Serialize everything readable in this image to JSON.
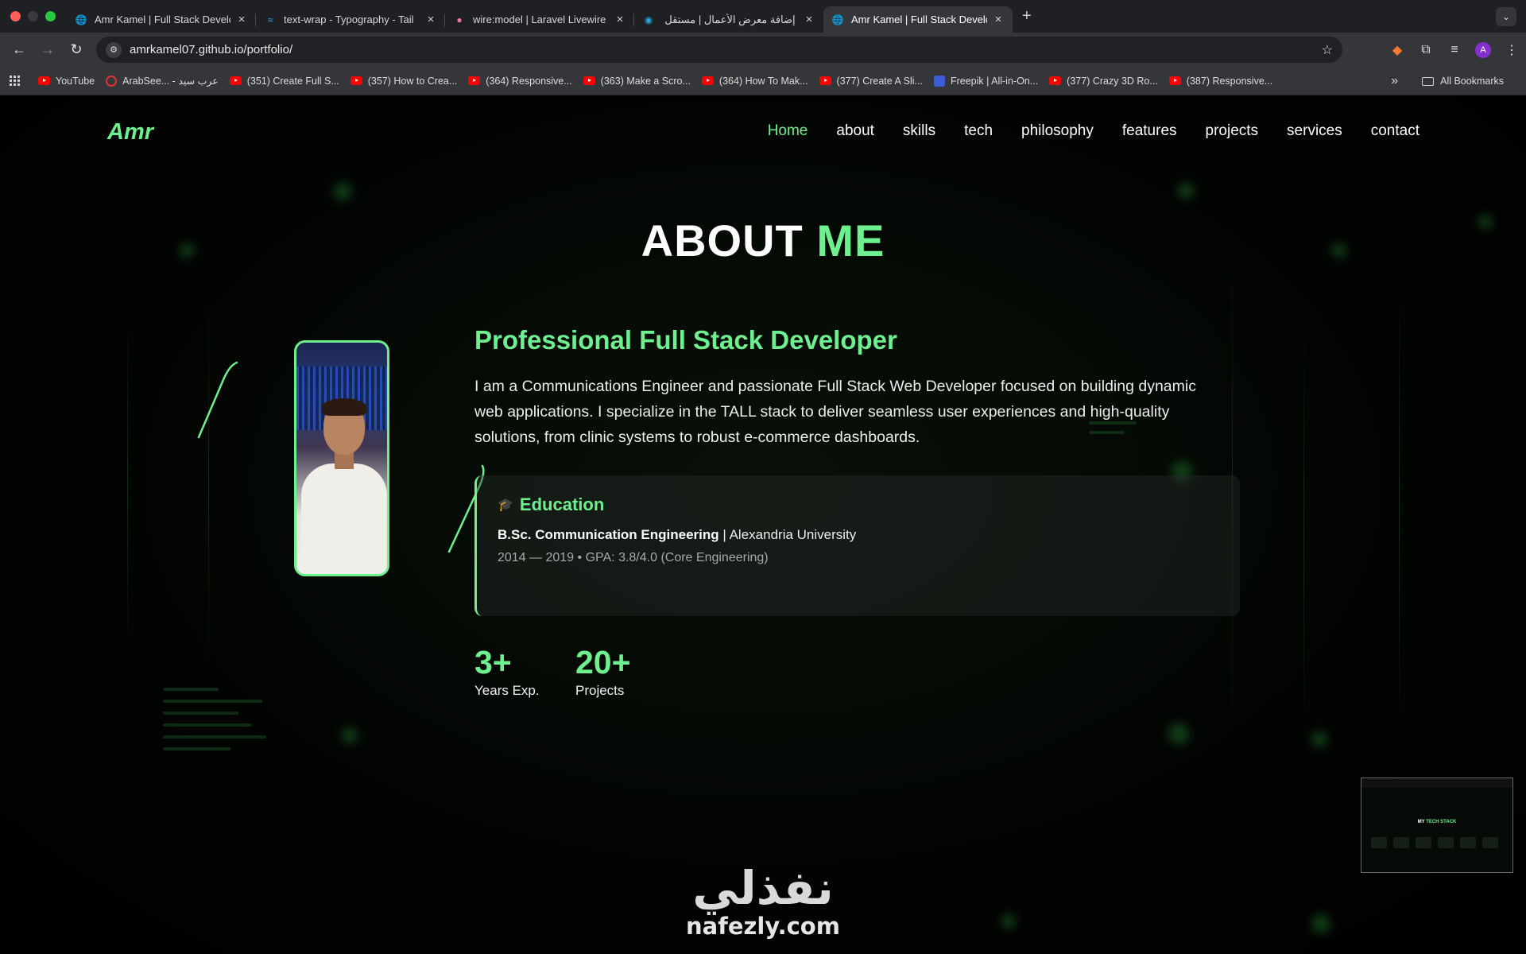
{
  "browser": {
    "tabs": [
      {
        "title": "Amr Kamel | Full Stack Develo",
        "icon": "globe-icon"
      },
      {
        "title": "text-wrap - Typography - Tail",
        "icon": "tailwind-icon"
      },
      {
        "title": "wire:model | Laravel Livewire",
        "icon": "livewire-icon"
      },
      {
        "title": "إضافة معرض الأعمال | مستقل",
        "icon": "mostaql-icon"
      },
      {
        "title": "Amr Kamel | Full Stack Develo",
        "icon": "globe-icon",
        "active": true
      }
    ],
    "url": "amrkamel07.github.io/portfolio/",
    "profile_initial": "A",
    "bookmarks": [
      {
        "label": "YouTube",
        "icon": "youtube-icon"
      },
      {
        "label": "ArabSee... - عرب سيد",
        "icon": "arabseed-icon"
      },
      {
        "label": "(351) Create Full S...",
        "icon": "youtube-icon"
      },
      {
        "label": "(357) How to Crea...",
        "icon": "youtube-icon"
      },
      {
        "label": "(364) Responsive...",
        "icon": "youtube-icon"
      },
      {
        "label": "(363) Make a Scro...",
        "icon": "youtube-icon"
      },
      {
        "label": "(364) How To Mak...",
        "icon": "youtube-icon"
      },
      {
        "label": "(377) Create A Sli...",
        "icon": "youtube-icon"
      },
      {
        "label": "Freepik | All-in-On...",
        "icon": "freepik-icon"
      },
      {
        "label": "(377) Crazy 3D Ro...",
        "icon": "youtube-icon"
      },
      {
        "label": "(387) Responsive...",
        "icon": "youtube-icon"
      }
    ],
    "more_bookmarks": "»",
    "all_bookmarks": "All Bookmarks"
  },
  "site": {
    "logo": "Amr",
    "nav": [
      "Home",
      "about",
      "skills",
      "tech",
      "philosophy",
      "features",
      "projects",
      "services",
      "contact"
    ],
    "active_nav": "Home",
    "accent": "#6ef08f"
  },
  "about": {
    "title_white": "ABOUT",
    "title_green": "ME",
    "headline": "Professional Full Stack Developer",
    "bio": "I am a Communications Engineer and passionate Full Stack Web Developer focused on building dynamic web applications. I specialize in the TALL stack to deliver seamless user experiences and high-quality solutions, from clinic systems to robust e-commerce dashboards.",
    "education": {
      "heading": "Education",
      "degree": "B.Sc. Communication Engineering",
      "separator": "|",
      "school": "Alexandria University",
      "meta": "2014 — 2019 • GPA: 3.8/4.0 (Core Engineering)"
    },
    "stats": [
      {
        "value": "3+",
        "label": "Years Exp."
      },
      {
        "value": "20+",
        "label": "Projects"
      }
    ]
  },
  "preview": {
    "title_white": "MY",
    "title_green": "TECH STACK"
  },
  "watermark": {
    "arabic": "نفذلي",
    "latin": "nafezly.com"
  }
}
